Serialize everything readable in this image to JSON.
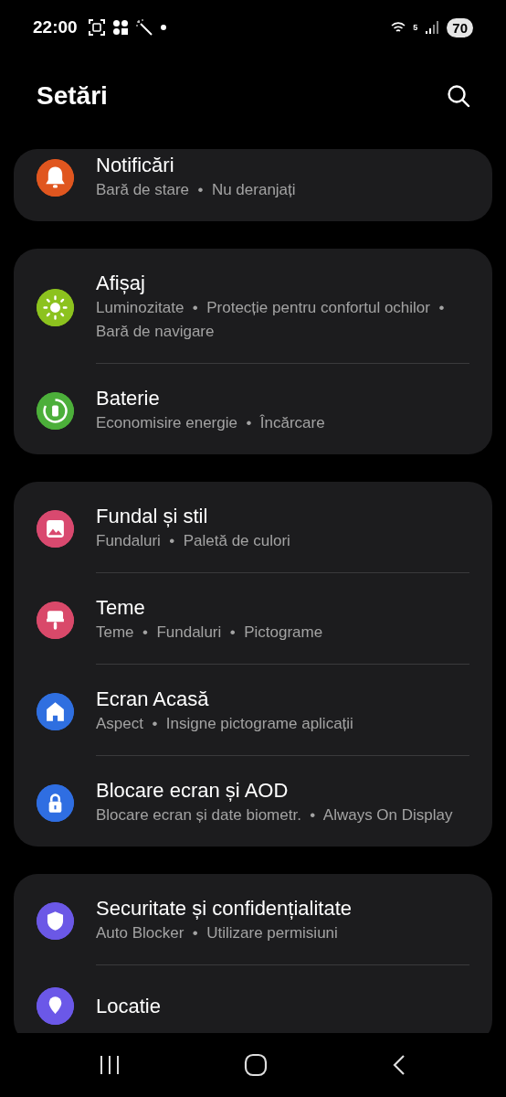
{
  "status_bar": {
    "time": "22:00",
    "network": "5",
    "battery": "70"
  },
  "header": {
    "title": "Setări"
  },
  "groups": [
    {
      "items": [
        {
          "title": "Notificări",
          "subtitle": "Bară de stare  •  Nu deranjați",
          "color": "#e0561f"
        }
      ]
    },
    {
      "items": [
        {
          "title": "Afișaj",
          "subtitle": "Luminozitate  •  Protecție pentru confortul ochilor  •  Bară de navigare",
          "color": "#8cc21e"
        },
        {
          "title": "Baterie",
          "subtitle": "Economisire energie  •  Încărcare",
          "color": "#4caf3a"
        }
      ]
    },
    {
      "items": [
        {
          "title": "Fundal și stil",
          "subtitle": "Fundaluri  •  Paletă de culori",
          "color": "#d9496f"
        },
        {
          "title": "Teme",
          "subtitle": "Teme  •  Fundaluri  •  Pictograme",
          "color": "#d9496a"
        },
        {
          "title": "Ecran Acasă",
          "subtitle": "Aspect  •  Insigne pictograme aplicații",
          "color": "#2f6fe0"
        },
        {
          "title": "Blocare ecran și AOD",
          "subtitle": "Blocare ecran și date biometr.  •  Always On Display",
          "color": "#2f6ee2"
        }
      ]
    },
    {
      "items": [
        {
          "title": "Securitate și confidențialitate",
          "subtitle": "Auto Blocker  •  Utilizare permisiuni",
          "color": "#6b58e6"
        },
        {
          "title": "Locatie",
          "color": "#6b58e8"
        }
      ]
    }
  ]
}
